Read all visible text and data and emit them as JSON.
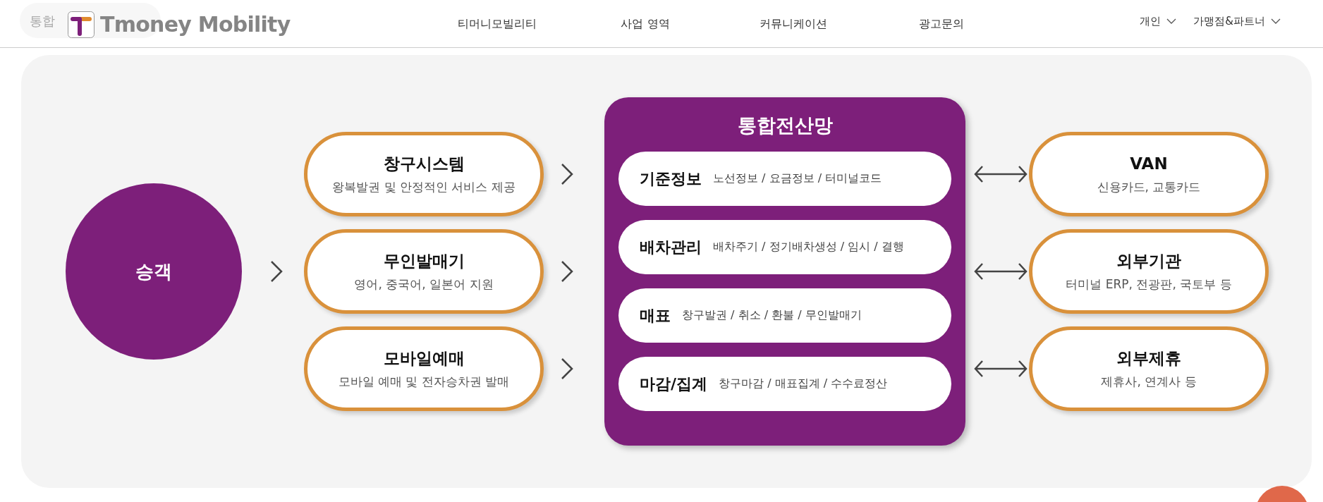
{
  "header": {
    "faded_title": "통합",
    "logo_text": "Tmoney Mobility",
    "nav": [
      "티머니모빌리티",
      "사업 영역",
      "커뮤니케이션",
      "광고문의"
    ],
    "menus": [
      "개인",
      "가맹점&파트너"
    ]
  },
  "passenger": {
    "label": "승객"
  },
  "channels": [
    {
      "title": "창구시스템",
      "desc": "왕복발권 및 안정적인 서비스 제공"
    },
    {
      "title": "무인발매기",
      "desc": "영어, 중국어, 일본어 지원"
    },
    {
      "title": "모바일예매",
      "desc": "모바일 예매 및 전자승차권 발매"
    }
  ],
  "network": {
    "title": "통합전산망",
    "rows": [
      {
        "label": "기준정보",
        "desc": "노선정보 / 요금정보 / 터미널코드"
      },
      {
        "label": "배차관리",
        "desc": "배차주기 / 정기배차생성 / 임시 / 결행"
      },
      {
        "label": "매표",
        "desc": "창구발권 / 취소 / 환불 / 무인발매기"
      },
      {
        "label": "마감/집계",
        "desc": "창구마감 / 매표집계 / 수수료정산"
      }
    ]
  },
  "partners": [
    {
      "title": "VAN",
      "desc": "신용카드, 교통카드"
    },
    {
      "title": "외부기관",
      "desc": "터미널 ERP, 전광판, 국토부 등"
    },
    {
      "title": "외부제휴",
      "desc": "제휴사, 연계사 등"
    }
  ]
}
